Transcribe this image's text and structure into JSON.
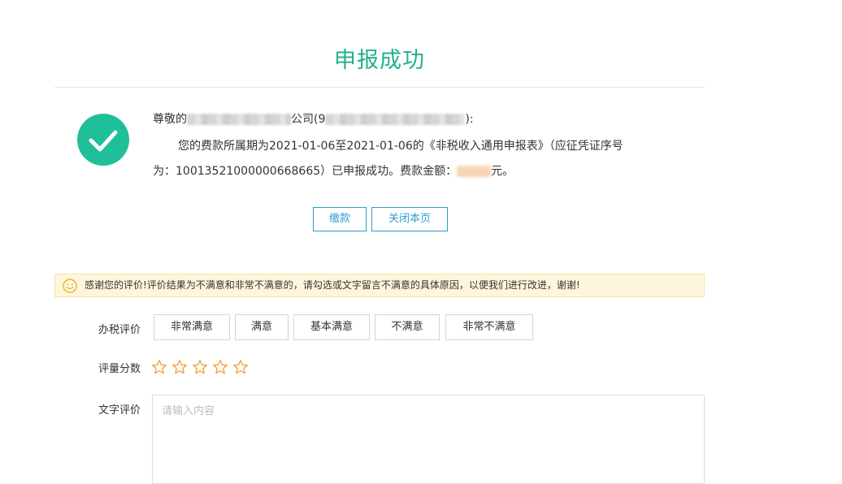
{
  "page": {
    "title": "申报成功"
  },
  "message": {
    "greeting_prefix": "尊敬的",
    "greeting_company_suffix": "公司(9",
    "greeting_end": "):",
    "line2": "您的费款所属期为2021-01-06至2021-01-06的《非税收入通用申报表》（应征凭证序号",
    "line3_prefix": "为：10013521000000668665）已申报成功。费款金额：",
    "line3_suffix": "元。"
  },
  "buttons": {
    "pay": "缴款",
    "close": "关闭本页"
  },
  "notice": {
    "text": "感谢您的评价!评价结果为不满意和非常不满意的，请勾选或文字留言不满意的具体原因，以便我们进行改进，谢谢!"
  },
  "rating": {
    "label": "办税评价",
    "options": [
      "非常满意",
      "满意",
      "基本满意",
      "不满意",
      "非常不满意"
    ]
  },
  "score": {
    "label": "评量分数",
    "stars_filled": 0,
    "stars_total": 5
  },
  "comment": {
    "label": "文字评价",
    "placeholder": "请输入内容"
  },
  "colors": {
    "accent_green": "#22b08f",
    "check_green": "#1fbf9a",
    "button_blue": "#2a9fd0",
    "star_orange": "#f0a030",
    "notice_bg": "#fdf6dc"
  }
}
